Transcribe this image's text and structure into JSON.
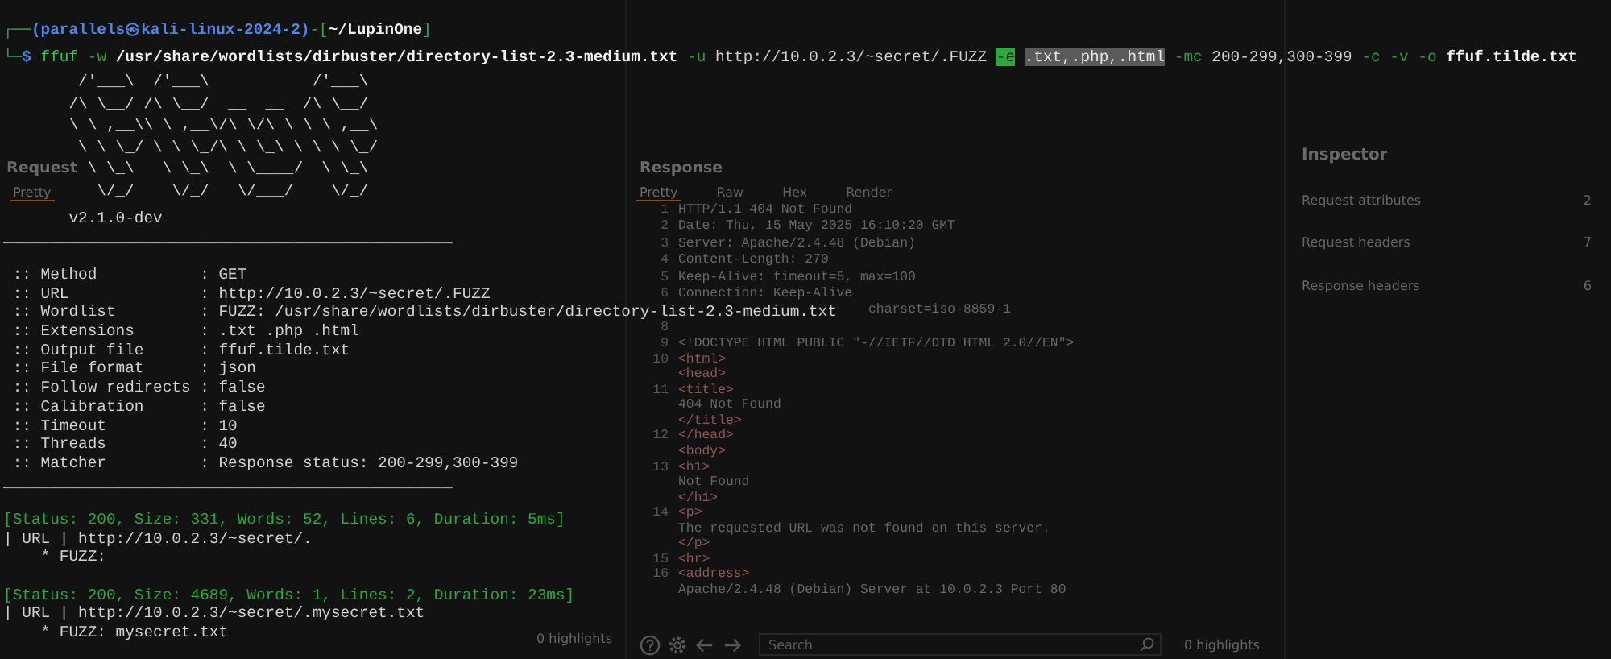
{
  "terminal": {
    "prompt": [
      {
        "text": "┌──",
        "kind": "frame"
      },
      {
        "text": "(parallels㉿kali-linux-2024-2)",
        "kind": "host"
      },
      {
        "text": "-[",
        "kind": "frame"
      },
      {
        "text": "~/LupinOne",
        "kind": "cwd"
      },
      {
        "text": "]",
        "kind": "frame"
      }
    ],
    "command": [
      {
        "text": "└─",
        "kind": "frame"
      },
      {
        "text": "$",
        "kind": "dollar"
      },
      {
        "text": "ffuf",
        "kind": "command"
      },
      {
        "text": "-w",
        "kind": "flag"
      },
      {
        "text": "/usr/share/wordlists/dirbuster/directory-list-2.3-medium.txt",
        "kind": "path"
      },
      {
        "text": "-u",
        "kind": "flag"
      },
      {
        "text": "http://10.0.2.3/~secret/.FUZZ",
        "kind": "arg"
      },
      {
        "text": "-e",
        "kind": "flag-marked"
      },
      {
        "text": ".txt,.php,.html",
        "kind": "arg-marked"
      },
      {
        "text": "-mc",
        "kind": "flag"
      },
      {
        "text": "200-299,300-399",
        "kind": "arg"
      },
      {
        "text": "-c",
        "kind": "flag"
      },
      {
        "text": "-v",
        "kind": "flag"
      },
      {
        "text": "-o",
        "kind": "flag"
      },
      {
        "text": "ffuf.tilde.txt",
        "kind": "path"
      }
    ],
    "banner": [
      "        /'___\\  /'___\\           /'___\\",
      "       /\\ \\__/ /\\ \\__/  __  __  /\\ \\__/",
      "       \\ \\ ,__\\\\ \\ ,__\\/\\ \\/\\ \\ \\ \\ ,__\\",
      "        \\ \\ \\_/ \\ \\ \\_/\\ \\ \\_\\ \\ \\ \\ \\_/",
      "         \\ \\_\\   \\ \\_\\  \\ \\____/  \\ \\_\\",
      "          \\/_/    \\/_/   \\/___/    \\/_/"
    ],
    "version": "       v2.1.0-dev",
    "separator": "________________________________________________",
    "config": [
      " :: Method           : GET",
      " :: URL              : http://10.0.2.3/~secret/.FUZZ",
      " :: Wordlist         : FUZZ: /usr/share/wordlists/dirbuster/directory-list-2.3-medium.txt",
      " :: Extensions       : .txt .php .html",
      " :: Output file      : ffuf.tilde.txt",
      " :: File format      : json",
      " :: Follow redirects : false",
      " :: Calibration      : false",
      " :: Timeout          : 10",
      " :: Threads          : 40",
      " :: Matcher          : Response status: 200-299,300-399"
    ],
    "closing_separator": "________________________________________________",
    "results": [
      {
        "status": "[Status: 200, Size: 331, Words: 52, Lines: 6, Duration: 5ms]",
        "url": "| URL | http://10.0.2.3/~secret/.",
        "fuzz": "    * FUZZ:"
      },
      {
        "status": "[Status: 200, Size: 4689, Words: 1, Lines: 2, Duration: 23ms]",
        "url": "| URL | http://10.0.2.3/~secret/.mysecret.txt",
        "fuzz": "    * FUZZ: mysecret.txt"
      }
    ]
  },
  "background_window": {
    "request": {
      "title": "Request",
      "tabs": [
        {
          "label": "Pretty",
          "selected": true
        }
      ],
      "highlights": "0 highlights"
    },
    "response": {
      "title": "Response",
      "tabs": [
        {
          "label": "Pretty",
          "selected": true
        },
        {
          "label": "Raw",
          "selected": false
        },
        {
          "label": "Hex",
          "selected": false
        },
        {
          "label": "Render",
          "selected": false
        }
      ],
      "lines": [
        {
          "number": "1",
          "text": "HTTP/1.1 404 Not Found",
          "kind": "plain"
        },
        {
          "number": "2",
          "text": "Date: Thu, 15 May 2025 16:10:20 GMT",
          "kind": "plain"
        },
        {
          "number": "3",
          "text": "Server: Apache/2.4.48 (Debian)",
          "kind": "plain"
        },
        {
          "number": "4",
          "text": "Content-Length: 270",
          "kind": "plain"
        },
        {
          "number": "5",
          "text": "Keep-Alive: timeout=5, max=100",
          "kind": "plain"
        },
        {
          "number": "6",
          "text": "Connection: Keep-Alive",
          "kind": "plain"
        },
        {
          "text": "charset=iso-8859-1",
          "kind": "tail"
        },
        {
          "number": "8"
        },
        {
          "number": "9",
          "text": "<!DOCTYPE HTML PUBLIC \"-//IETF//DTD HTML 2.0//EN\">",
          "kind": "plain"
        },
        {
          "number": "10",
          "text": "<html>",
          "kind": "tag"
        },
        {
          "text": "  <head>",
          "kind": "tag"
        },
        {
          "number": "11",
          "text": "    <title>",
          "kind": "tag"
        },
        {
          "text": "      404 Not Found",
          "kind": "plain"
        },
        {
          "text": "    </title>",
          "kind": "tag"
        },
        {
          "number": "12",
          "text": "  </head>",
          "kind": "tag"
        },
        {
          "text": "  <body>",
          "kind": "tag"
        },
        {
          "number": "13",
          "text": "    <h1>",
          "kind": "tag"
        },
        {
          "text": "      Not Found",
          "kind": "plain"
        },
        {
          "text": "    </h1>",
          "kind": "tag"
        },
        {
          "number": "14",
          "text": "    <p>",
          "kind": "tag"
        },
        {
          "text": "      The requested URL was not found on this server.",
          "kind": "plain"
        },
        {
          "text": "    </p>",
          "kind": "tag"
        },
        {
          "number": "15",
          "text": "    <hr>",
          "kind": "tag"
        },
        {
          "number": "16",
          "text": "    <address>",
          "kind": "tag"
        },
        {
          "text": "      Apache/2.4.48 (Debian) Server at 10.0.2.3 Port 80",
          "kind": "plain"
        }
      ],
      "search": {
        "placeholder": "Search"
      },
      "highlights": "0 highlights"
    },
    "inspector": {
      "title": "Inspector",
      "rows": [
        {
          "label": "Request attributes",
          "count": "2"
        },
        {
          "label": "Request headers",
          "count": "7"
        },
        {
          "label": "Response headers",
          "count": "6"
        }
      ]
    }
  }
}
